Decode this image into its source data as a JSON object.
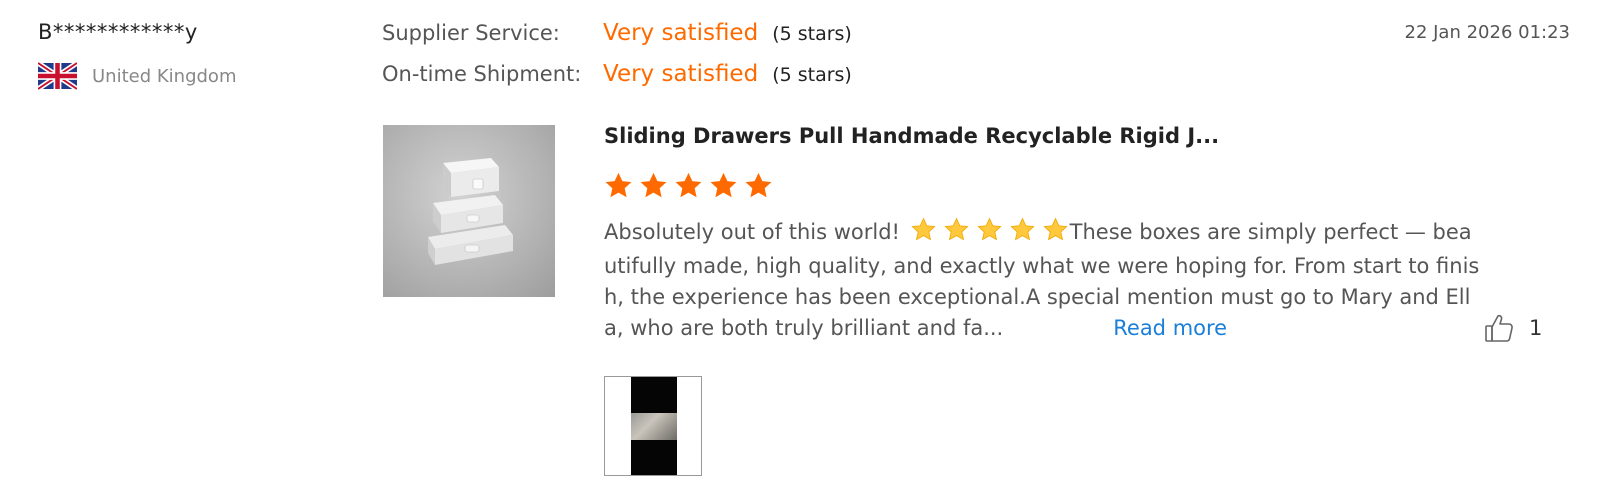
{
  "reviewer": {
    "name": "B************y",
    "country": "United Kingdom",
    "flag_icon": "uk-flag-icon"
  },
  "ratings": [
    {
      "label": "Supplier Service:",
      "value": "Very satisfied",
      "stars_text": "(5 stars)"
    },
    {
      "label": "On-time Shipment:",
      "value": "Very satisfied",
      "stars_text": "(5 stars)"
    }
  ],
  "review": {
    "date": "22 Jan 2026 01:23",
    "product_title": "Sliding Drawers Pull Handmade Recyclable Rigid J...",
    "product_rating": 5,
    "text_intro": "Absolutely out of this world!",
    "text_body": "These boxes are simply perfect — beautifully made, high quality, and exactly what we were hoping for. From start to finish, the experience has been exceptional.A special mention must go to Mary and Ella, who are both truly brilliant and fa...",
    "read_more": "Read more",
    "helpful_count": "1"
  },
  "colors": {
    "accent": "#ff6a00",
    "link": "#1a7fd8",
    "emoji_star": "#ffc83d"
  },
  "icons": {
    "star": "star-icon",
    "thumb": "thumbs-up-icon"
  }
}
